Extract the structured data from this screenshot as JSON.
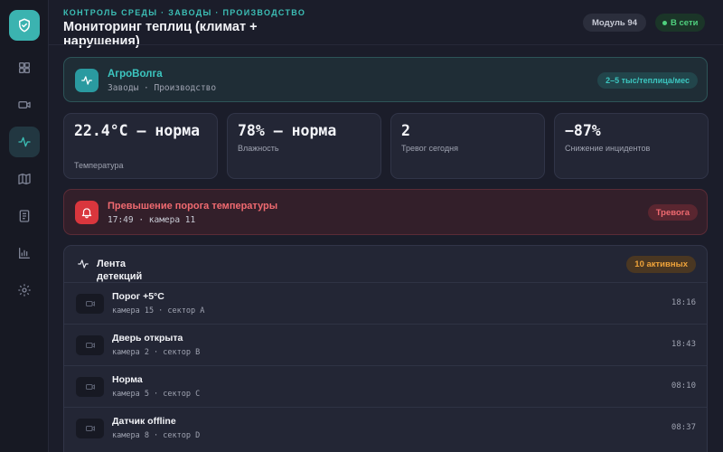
{
  "header": {
    "breadcrumb": "КОНТРОЛЬ СРЕДЫ · ЗАВОДЫ · ПРОИЗВОДСТВО",
    "title": "Мониторинг теплиц (климат + нарушения)",
    "module_label": "Модуль 94",
    "status_label": "В сети"
  },
  "sidebar": {
    "items": [
      {
        "icon": "dashboard-icon",
        "active": false
      },
      {
        "icon": "camera-icon",
        "active": false
      },
      {
        "icon": "activity-icon",
        "active": true
      },
      {
        "icon": "map-icon",
        "active": false
      },
      {
        "icon": "document-icon",
        "active": false
      },
      {
        "icon": "bar-chart-icon",
        "active": false
      },
      {
        "icon": "settings-icon",
        "active": false
      }
    ]
  },
  "org": {
    "name": "АгроВолга",
    "subtitle": "Заводы · Производство",
    "price": "2–5 тыс/теплица/мес"
  },
  "stats": [
    {
      "value": "22.4°C — норма",
      "label": "Температура"
    },
    {
      "value": "78% — норма",
      "label": "Влажность"
    },
    {
      "value": "2",
      "label": "Тревог сегодня"
    },
    {
      "value": "−87%",
      "label": "Снижение инцидентов"
    }
  ],
  "alert": {
    "title": "Превышение порога температуры",
    "subtitle": "17:49 · камера 11",
    "badge": "Тревога"
  },
  "feed": {
    "title": "Лента детекций",
    "badge": "10 активных",
    "rows": [
      {
        "title": "Порог +5°C",
        "subtitle": "камера 15 · сектор A",
        "time": "18:16"
      },
      {
        "title": "Дверь открыта",
        "subtitle": "камера 2 · сектор B",
        "time": "18:43"
      },
      {
        "title": "Норма",
        "subtitle": "камера 5 · сектор C",
        "time": "08:10"
      },
      {
        "title": "Датчик offline",
        "subtitle": "камера 8 · сектор D",
        "time": "08:37"
      }
    ]
  },
  "colors": {
    "accent": "#3cbfb6",
    "online": "#4fd07e",
    "alert": "#d9363d",
    "warning": "#efa33a"
  }
}
